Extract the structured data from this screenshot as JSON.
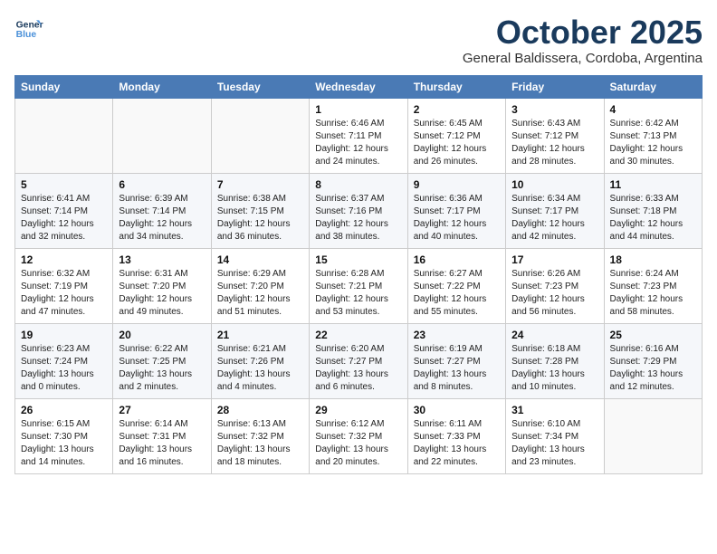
{
  "header": {
    "logo_line1": "General",
    "logo_line2": "Blue",
    "month": "October 2025",
    "location": "General Baldissera, Cordoba, Argentina"
  },
  "weekdays": [
    "Sunday",
    "Monday",
    "Tuesday",
    "Wednesday",
    "Thursday",
    "Friday",
    "Saturday"
  ],
  "weeks": [
    [
      {
        "day": "",
        "info": ""
      },
      {
        "day": "",
        "info": ""
      },
      {
        "day": "",
        "info": ""
      },
      {
        "day": "1",
        "info": "Sunrise: 6:46 AM\nSunset: 7:11 PM\nDaylight: 12 hours\nand 24 minutes."
      },
      {
        "day": "2",
        "info": "Sunrise: 6:45 AM\nSunset: 7:12 PM\nDaylight: 12 hours\nand 26 minutes."
      },
      {
        "day": "3",
        "info": "Sunrise: 6:43 AM\nSunset: 7:12 PM\nDaylight: 12 hours\nand 28 minutes."
      },
      {
        "day": "4",
        "info": "Sunrise: 6:42 AM\nSunset: 7:13 PM\nDaylight: 12 hours\nand 30 minutes."
      }
    ],
    [
      {
        "day": "5",
        "info": "Sunrise: 6:41 AM\nSunset: 7:14 PM\nDaylight: 12 hours\nand 32 minutes."
      },
      {
        "day": "6",
        "info": "Sunrise: 6:39 AM\nSunset: 7:14 PM\nDaylight: 12 hours\nand 34 minutes."
      },
      {
        "day": "7",
        "info": "Sunrise: 6:38 AM\nSunset: 7:15 PM\nDaylight: 12 hours\nand 36 minutes."
      },
      {
        "day": "8",
        "info": "Sunrise: 6:37 AM\nSunset: 7:16 PM\nDaylight: 12 hours\nand 38 minutes."
      },
      {
        "day": "9",
        "info": "Sunrise: 6:36 AM\nSunset: 7:17 PM\nDaylight: 12 hours\nand 40 minutes."
      },
      {
        "day": "10",
        "info": "Sunrise: 6:34 AM\nSunset: 7:17 PM\nDaylight: 12 hours\nand 42 minutes."
      },
      {
        "day": "11",
        "info": "Sunrise: 6:33 AM\nSunset: 7:18 PM\nDaylight: 12 hours\nand 44 minutes."
      }
    ],
    [
      {
        "day": "12",
        "info": "Sunrise: 6:32 AM\nSunset: 7:19 PM\nDaylight: 12 hours\nand 47 minutes."
      },
      {
        "day": "13",
        "info": "Sunrise: 6:31 AM\nSunset: 7:20 PM\nDaylight: 12 hours\nand 49 minutes."
      },
      {
        "day": "14",
        "info": "Sunrise: 6:29 AM\nSunset: 7:20 PM\nDaylight: 12 hours\nand 51 minutes."
      },
      {
        "day": "15",
        "info": "Sunrise: 6:28 AM\nSunset: 7:21 PM\nDaylight: 12 hours\nand 53 minutes."
      },
      {
        "day": "16",
        "info": "Sunrise: 6:27 AM\nSunset: 7:22 PM\nDaylight: 12 hours\nand 55 minutes."
      },
      {
        "day": "17",
        "info": "Sunrise: 6:26 AM\nSunset: 7:23 PM\nDaylight: 12 hours\nand 56 minutes."
      },
      {
        "day": "18",
        "info": "Sunrise: 6:24 AM\nSunset: 7:23 PM\nDaylight: 12 hours\nand 58 minutes."
      }
    ],
    [
      {
        "day": "19",
        "info": "Sunrise: 6:23 AM\nSunset: 7:24 PM\nDaylight: 13 hours\nand 0 minutes."
      },
      {
        "day": "20",
        "info": "Sunrise: 6:22 AM\nSunset: 7:25 PM\nDaylight: 13 hours\nand 2 minutes."
      },
      {
        "day": "21",
        "info": "Sunrise: 6:21 AM\nSunset: 7:26 PM\nDaylight: 13 hours\nand 4 minutes."
      },
      {
        "day": "22",
        "info": "Sunrise: 6:20 AM\nSunset: 7:27 PM\nDaylight: 13 hours\nand 6 minutes."
      },
      {
        "day": "23",
        "info": "Sunrise: 6:19 AM\nSunset: 7:27 PM\nDaylight: 13 hours\nand 8 minutes."
      },
      {
        "day": "24",
        "info": "Sunrise: 6:18 AM\nSunset: 7:28 PM\nDaylight: 13 hours\nand 10 minutes."
      },
      {
        "day": "25",
        "info": "Sunrise: 6:16 AM\nSunset: 7:29 PM\nDaylight: 13 hours\nand 12 minutes."
      }
    ],
    [
      {
        "day": "26",
        "info": "Sunrise: 6:15 AM\nSunset: 7:30 PM\nDaylight: 13 hours\nand 14 minutes."
      },
      {
        "day": "27",
        "info": "Sunrise: 6:14 AM\nSunset: 7:31 PM\nDaylight: 13 hours\nand 16 minutes."
      },
      {
        "day": "28",
        "info": "Sunrise: 6:13 AM\nSunset: 7:32 PM\nDaylight: 13 hours\nand 18 minutes."
      },
      {
        "day": "29",
        "info": "Sunrise: 6:12 AM\nSunset: 7:32 PM\nDaylight: 13 hours\nand 20 minutes."
      },
      {
        "day": "30",
        "info": "Sunrise: 6:11 AM\nSunset: 7:33 PM\nDaylight: 13 hours\nand 22 minutes."
      },
      {
        "day": "31",
        "info": "Sunrise: 6:10 AM\nSunset: 7:34 PM\nDaylight: 13 hours\nand 23 minutes."
      },
      {
        "day": "",
        "info": ""
      }
    ]
  ]
}
